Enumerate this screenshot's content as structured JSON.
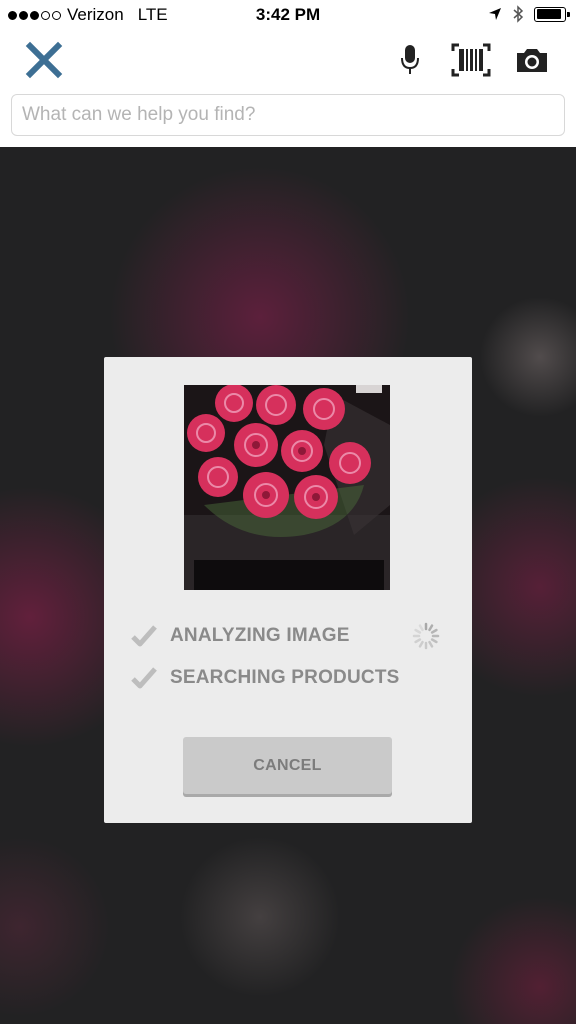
{
  "status_bar": {
    "carrier": "Verizon",
    "network": "LTE",
    "time": "3:42 PM",
    "signal_bars_filled": 3,
    "signal_bars_total": 5
  },
  "toolbar": {
    "close_icon": "close-icon",
    "mic_icon": "microphone-icon",
    "barcode_icon": "barcode-scanner-icon",
    "camera_icon": "camera-icon",
    "accent_color": "#3d6f94"
  },
  "search": {
    "placeholder": "What can we help you find?",
    "value": ""
  },
  "modal": {
    "steps": [
      {
        "label": "ANALYZING IMAGE",
        "status": "in-progress"
      },
      {
        "label": "SEARCHING PRODUCTS",
        "status": "pending"
      }
    ],
    "cancel_label": "CANCEL"
  }
}
